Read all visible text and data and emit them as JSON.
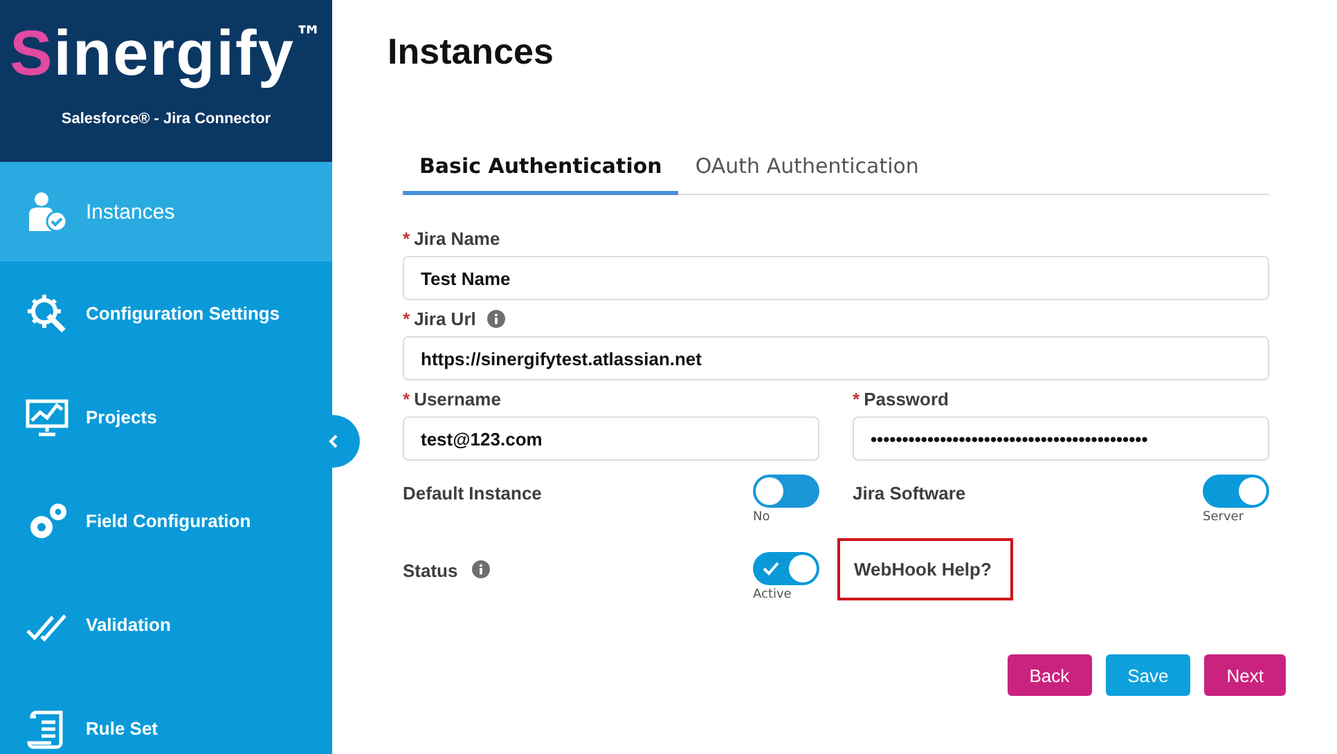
{
  "sidebar": {
    "logo": {
      "name": "Sinergify",
      "mark": "™"
    },
    "subtitle": "Salesforce® - Jira Connector",
    "items": [
      {
        "label": "Instances",
        "selected": true
      },
      {
        "label": "Configuration Settings",
        "selected": false
      },
      {
        "label": "Projects",
        "selected": false
      },
      {
        "label": "Field Configuration",
        "selected": false
      },
      {
        "label": "Validation",
        "selected": false
      },
      {
        "label": "Rule Set",
        "selected": false
      }
    ]
  },
  "page": {
    "title": "Instances"
  },
  "tabs": [
    {
      "label": "Basic Authentication",
      "selected": true
    },
    {
      "label": "OAuth Authentication",
      "selected": false
    }
  ],
  "fields": [
    {
      "label": "Jira Name",
      "required_mark": "*",
      "value": "Test Name"
    },
    {
      "label": "Jira Url",
      "required_mark": "*",
      "info": true,
      "value": "https://sinergifytest.atlassian.net"
    },
    {
      "label": "Username",
      "required_mark": "*",
      "value": "test@123.com"
    },
    {
      "label": "Password",
      "required_mark": "*",
      "value": "••••••••••••••••••••••••••••••••••••••••••••"
    }
  ],
  "toggles": [
    {
      "label": "Default Instance",
      "on": false,
      "caption": "No"
    },
    {
      "label": "Jira Software",
      "on": true,
      "caption": "Server"
    },
    {
      "label": "Status",
      "info": true,
      "on": true,
      "check": true,
      "caption": "Active"
    }
  ],
  "help_link": "WebHook Help?",
  "buttons": [
    {
      "label": "Back",
      "kind": "secondary"
    },
    {
      "label": "Save",
      "kind": "primary"
    },
    {
      "label": "Next",
      "kind": "secondary"
    }
  ]
}
